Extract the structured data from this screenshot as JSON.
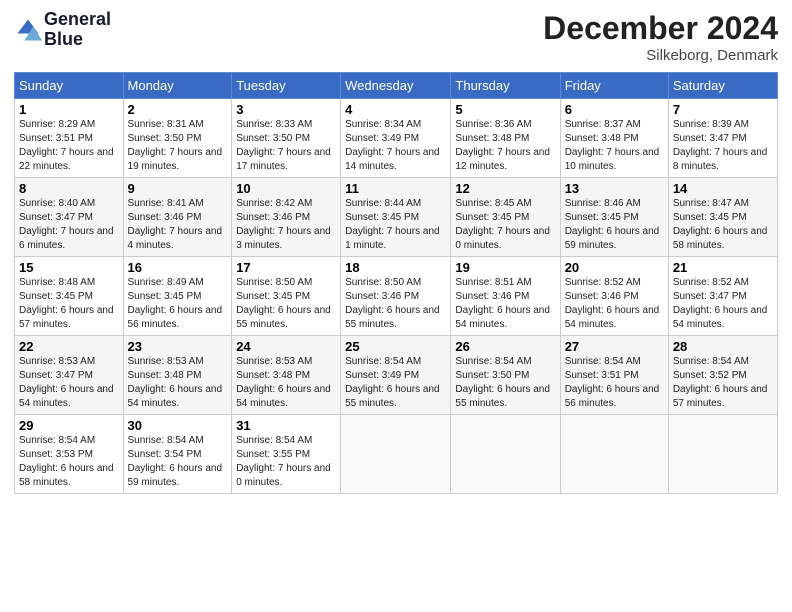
{
  "header": {
    "logo_line1": "General",
    "logo_line2": "Blue",
    "month": "December 2024",
    "location": "Silkeborg, Denmark"
  },
  "weekdays": [
    "Sunday",
    "Monday",
    "Tuesday",
    "Wednesday",
    "Thursday",
    "Friday",
    "Saturday"
  ],
  "weeks": [
    [
      {
        "day": 1,
        "sunrise": "8:29 AM",
        "sunset": "3:51 PM",
        "daylight": "7 hours and 22 minutes."
      },
      {
        "day": 2,
        "sunrise": "8:31 AM",
        "sunset": "3:50 PM",
        "daylight": "7 hours and 19 minutes."
      },
      {
        "day": 3,
        "sunrise": "8:33 AM",
        "sunset": "3:50 PM",
        "daylight": "7 hours and 17 minutes."
      },
      {
        "day": 4,
        "sunrise": "8:34 AM",
        "sunset": "3:49 PM",
        "daylight": "7 hours and 14 minutes."
      },
      {
        "day": 5,
        "sunrise": "8:36 AM",
        "sunset": "3:48 PM",
        "daylight": "7 hours and 12 minutes."
      },
      {
        "day": 6,
        "sunrise": "8:37 AM",
        "sunset": "3:48 PM",
        "daylight": "7 hours and 10 minutes."
      },
      {
        "day": 7,
        "sunrise": "8:39 AM",
        "sunset": "3:47 PM",
        "daylight": "7 hours and 8 minutes."
      }
    ],
    [
      {
        "day": 8,
        "sunrise": "8:40 AM",
        "sunset": "3:47 PM",
        "daylight": "7 hours and 6 minutes."
      },
      {
        "day": 9,
        "sunrise": "8:41 AM",
        "sunset": "3:46 PM",
        "daylight": "7 hours and 4 minutes."
      },
      {
        "day": 10,
        "sunrise": "8:42 AM",
        "sunset": "3:46 PM",
        "daylight": "7 hours and 3 minutes."
      },
      {
        "day": 11,
        "sunrise": "8:44 AM",
        "sunset": "3:45 PM",
        "daylight": "7 hours and 1 minute."
      },
      {
        "day": 12,
        "sunrise": "8:45 AM",
        "sunset": "3:45 PM",
        "daylight": "7 hours and 0 minutes."
      },
      {
        "day": 13,
        "sunrise": "8:46 AM",
        "sunset": "3:45 PM",
        "daylight": "6 hours and 59 minutes."
      },
      {
        "day": 14,
        "sunrise": "8:47 AM",
        "sunset": "3:45 PM",
        "daylight": "6 hours and 58 minutes."
      }
    ],
    [
      {
        "day": 15,
        "sunrise": "8:48 AM",
        "sunset": "3:45 PM",
        "daylight": "6 hours and 57 minutes."
      },
      {
        "day": 16,
        "sunrise": "8:49 AM",
        "sunset": "3:45 PM",
        "daylight": "6 hours and 56 minutes."
      },
      {
        "day": 17,
        "sunrise": "8:50 AM",
        "sunset": "3:45 PM",
        "daylight": "6 hours and 55 minutes."
      },
      {
        "day": 18,
        "sunrise": "8:50 AM",
        "sunset": "3:46 PM",
        "daylight": "6 hours and 55 minutes."
      },
      {
        "day": 19,
        "sunrise": "8:51 AM",
        "sunset": "3:46 PM",
        "daylight": "6 hours and 54 minutes."
      },
      {
        "day": 20,
        "sunrise": "8:52 AM",
        "sunset": "3:46 PM",
        "daylight": "6 hours and 54 minutes."
      },
      {
        "day": 21,
        "sunrise": "8:52 AM",
        "sunset": "3:47 PM",
        "daylight": "6 hours and 54 minutes."
      }
    ],
    [
      {
        "day": 22,
        "sunrise": "8:53 AM",
        "sunset": "3:47 PM",
        "daylight": "6 hours and 54 minutes."
      },
      {
        "day": 23,
        "sunrise": "8:53 AM",
        "sunset": "3:48 PM",
        "daylight": "6 hours and 54 minutes."
      },
      {
        "day": 24,
        "sunrise": "8:53 AM",
        "sunset": "3:48 PM",
        "daylight": "6 hours and 54 minutes."
      },
      {
        "day": 25,
        "sunrise": "8:54 AM",
        "sunset": "3:49 PM",
        "daylight": "6 hours and 55 minutes."
      },
      {
        "day": 26,
        "sunrise": "8:54 AM",
        "sunset": "3:50 PM",
        "daylight": "6 hours and 55 minutes."
      },
      {
        "day": 27,
        "sunrise": "8:54 AM",
        "sunset": "3:51 PM",
        "daylight": "6 hours and 56 minutes."
      },
      {
        "day": 28,
        "sunrise": "8:54 AM",
        "sunset": "3:52 PM",
        "daylight": "6 hours and 57 minutes."
      }
    ],
    [
      {
        "day": 29,
        "sunrise": "8:54 AM",
        "sunset": "3:53 PM",
        "daylight": "6 hours and 58 minutes."
      },
      {
        "day": 30,
        "sunrise": "8:54 AM",
        "sunset": "3:54 PM",
        "daylight": "6 hours and 59 minutes."
      },
      {
        "day": 31,
        "sunrise": "8:54 AM",
        "sunset": "3:55 PM",
        "daylight": "7 hours and 0 minutes."
      },
      null,
      null,
      null,
      null
    ]
  ]
}
